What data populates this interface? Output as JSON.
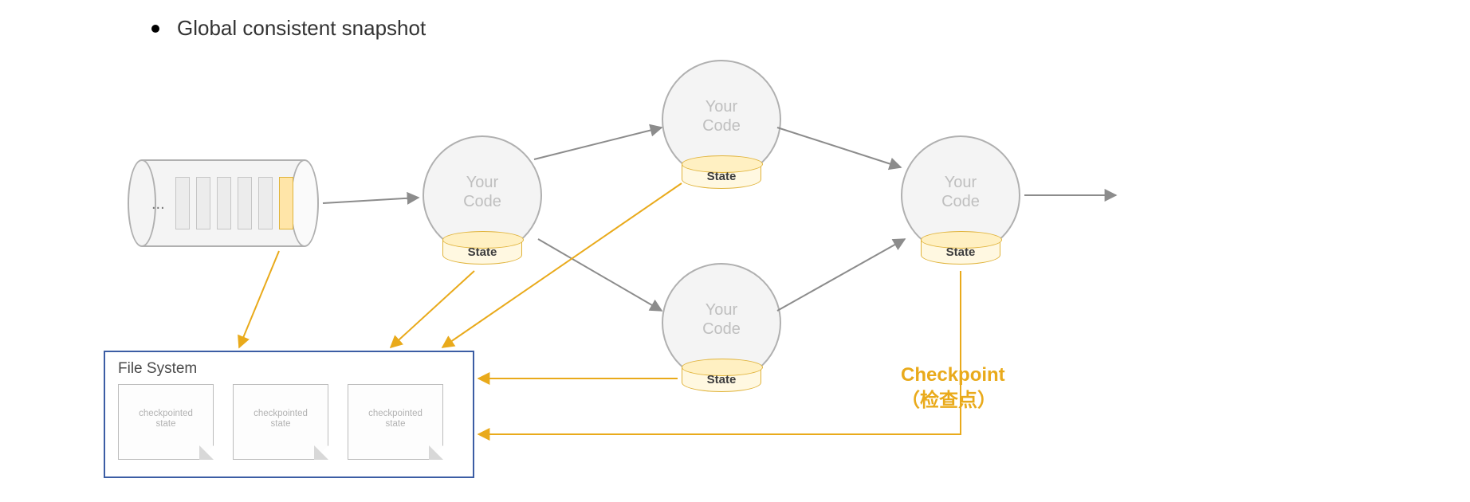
{
  "heading": "Global consistent snapshot",
  "source": {
    "ellipsis": "...",
    "highlighted_bar_index": 5
  },
  "operators": [
    {
      "label_line1": "Your",
      "label_line2": "Code",
      "state_label": "State"
    },
    {
      "label_line1": "Your",
      "label_line2": "Code",
      "state_label": "State"
    },
    {
      "label_line1": "Your",
      "label_line2": "Code",
      "state_label": "State"
    },
    {
      "label_line1": "Your",
      "label_line2": "Code",
      "state_label": "State"
    }
  ],
  "file_system": {
    "title": "File System",
    "docs": [
      {
        "line1": "checkpointed",
        "line2": "state"
      },
      {
        "line1": "checkpointed",
        "line2": "state"
      },
      {
        "line1": "checkpointed",
        "line2": "state"
      }
    ]
  },
  "checkpoint_label": {
    "line1": "Checkpoint",
    "line2": "（检查点）"
  }
}
